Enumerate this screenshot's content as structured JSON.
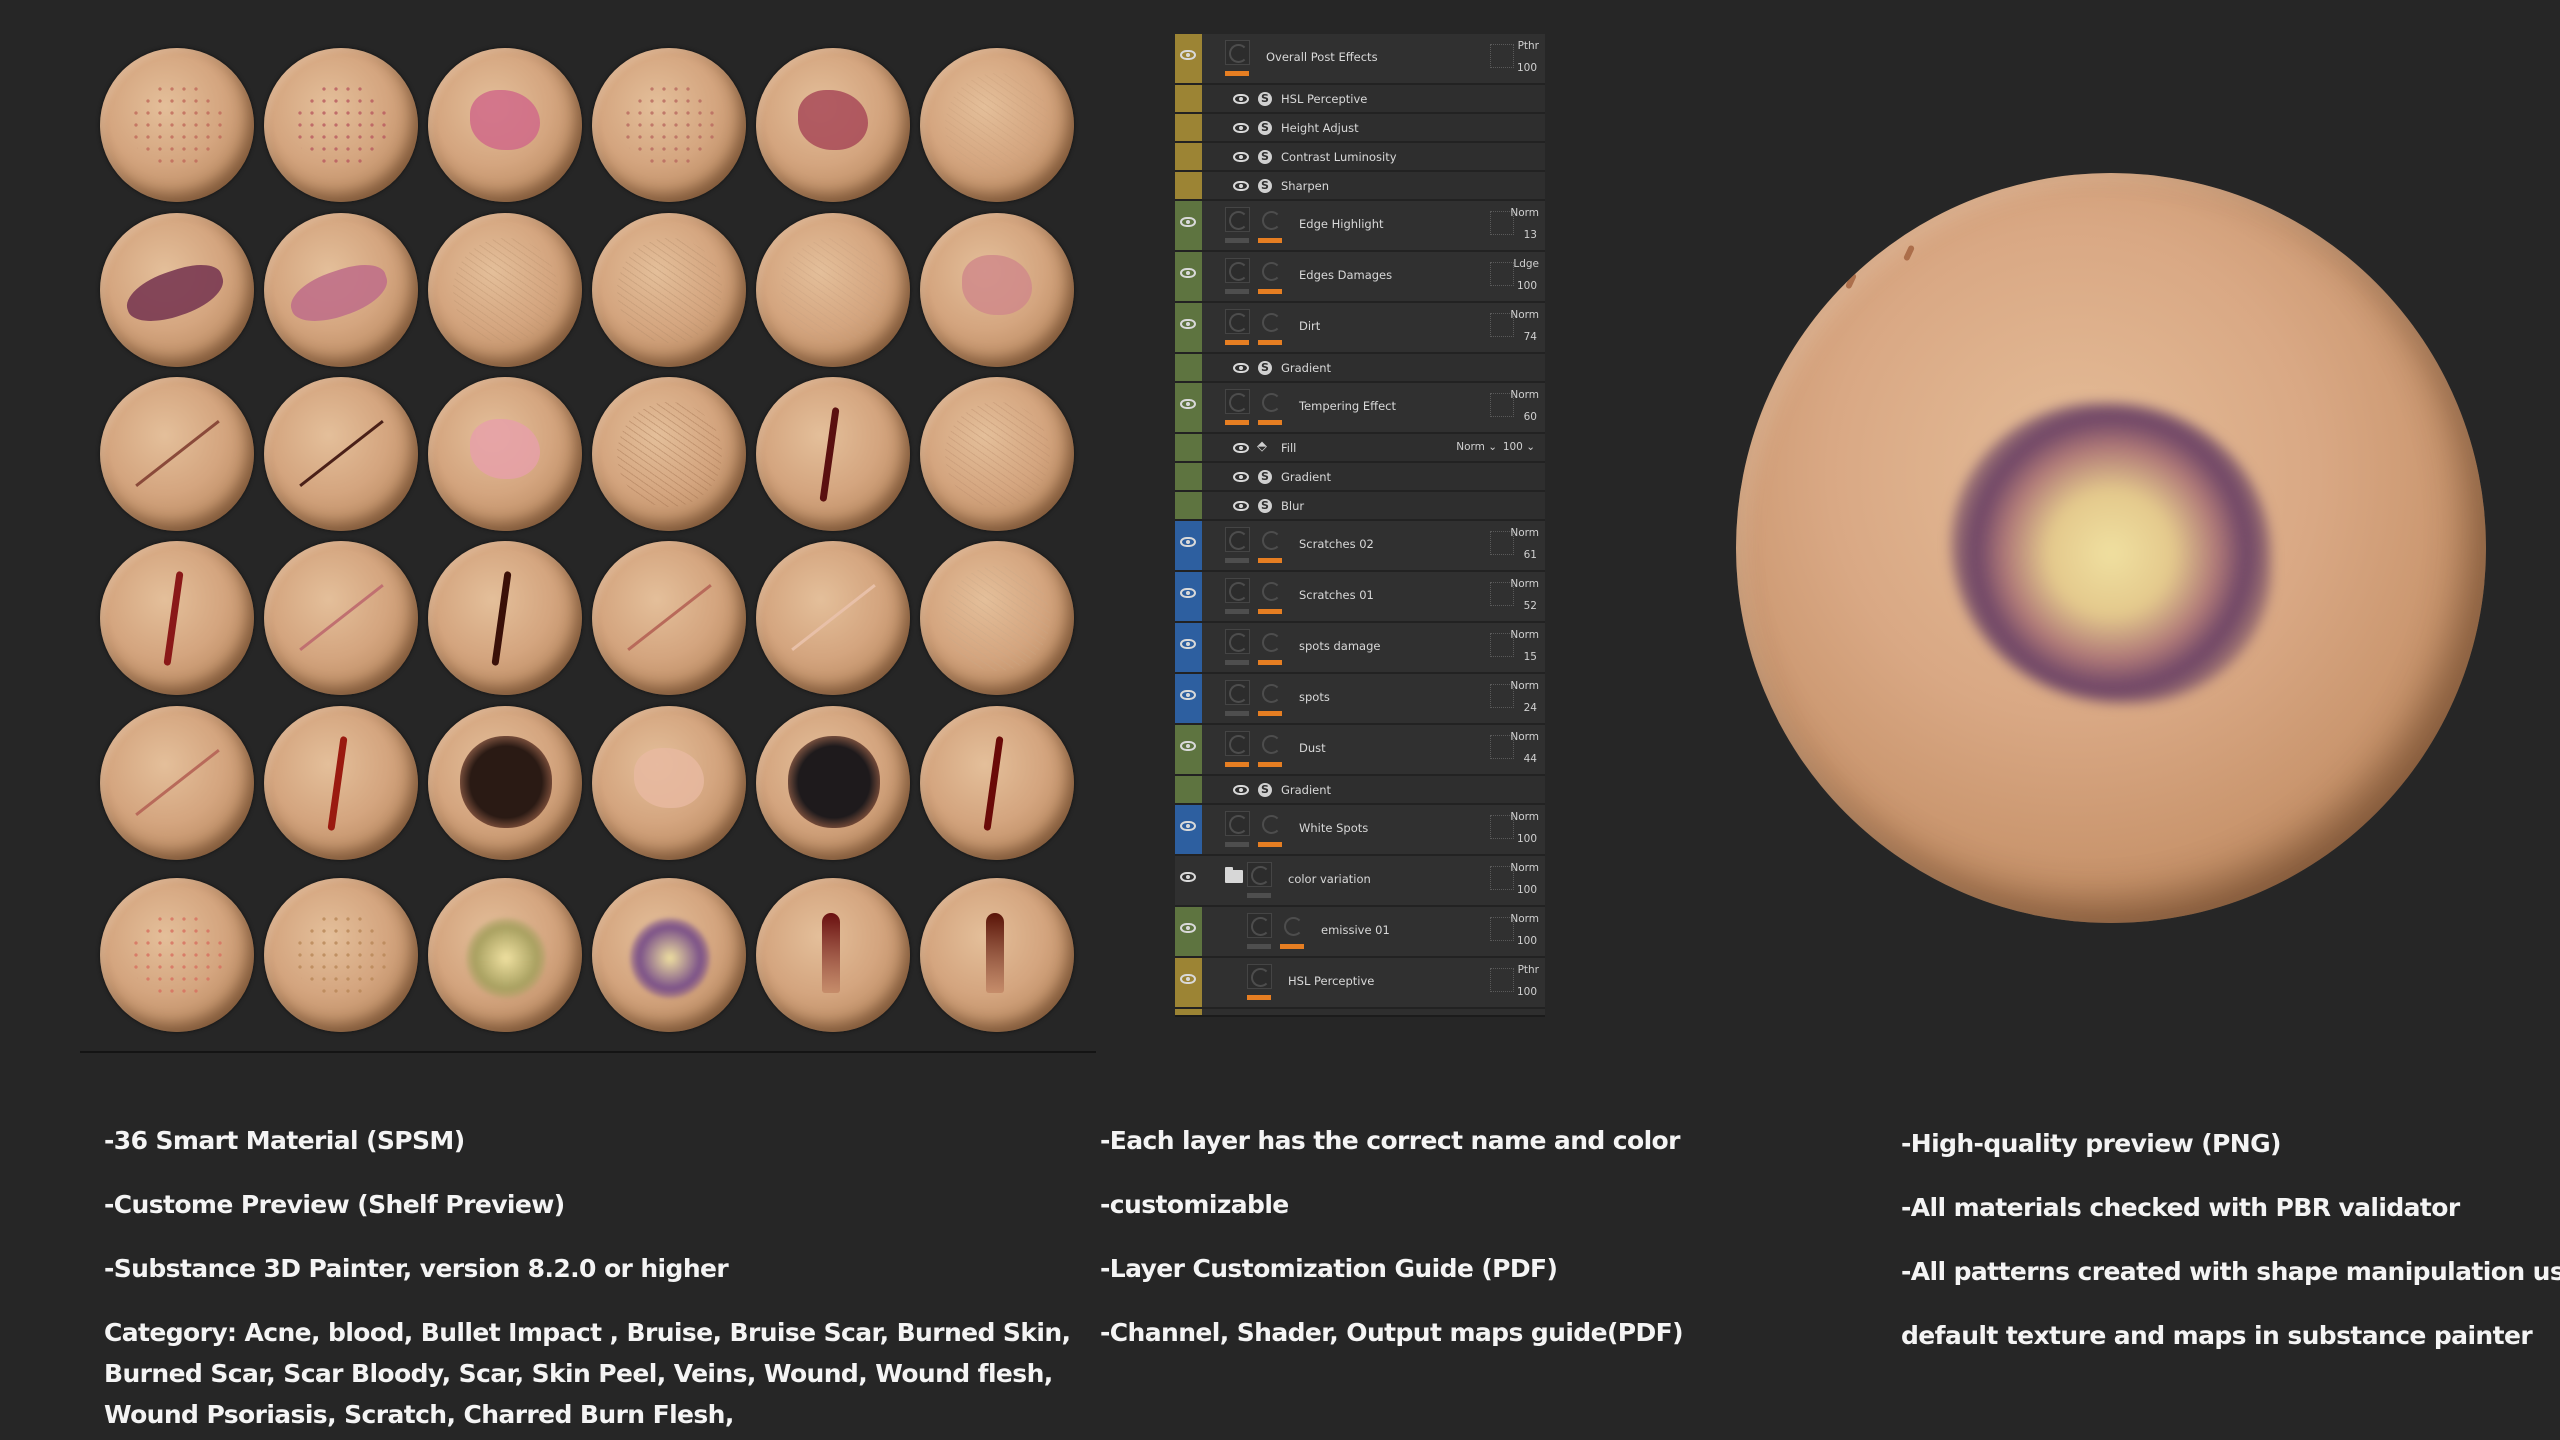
{
  "sphere_grid": {
    "count": 36,
    "rows": [
      [
        "acne red spots",
        "dense acne patches",
        "pink psoriasis patch",
        "acne scattered spots",
        "raw flesh wound",
        "bumpy skin texture"
      ],
      [
        "skin peel wound",
        "raw skin peel",
        "fine skin cracks",
        "cracked dry skin",
        "subtle veins",
        "pink rash"
      ],
      [
        "stitched scar",
        "dark scratch line",
        "burn pink patch",
        "hair-like scars",
        "bloody cut",
        "stretch texture"
      ],
      [
        "vertical bloody cut",
        "healed pink scratch",
        "dark scab wound",
        "scar line",
        "faint scratch",
        "rough burned scar"
      ],
      [
        "thin scratch",
        "bloody slash",
        "charred burn",
        "burned skin flesh",
        "charred burn flesh",
        "thin vertical cut"
      ],
      [
        "red acne dots",
        "bumpy acne",
        "green-yellow bruise",
        "purple bruise",
        "bullet impact drips",
        "bullet wound drip"
      ]
    ]
  },
  "layer_panel": {
    "layers": [
      {
        "kind": "main",
        "name": "Overall Post Effects",
        "strip": "#9c8434",
        "blend": "Pthr",
        "opacity": "100",
        "thumbs": 1,
        "bars": [
          "orange"
        ]
      },
      {
        "kind": "sub",
        "name": "HSL Perceptive",
        "strip": "#9c8434",
        "icon": "substance-icon"
      },
      {
        "kind": "sub",
        "name": "Height Adjust",
        "strip": "#9c8434",
        "icon": "substance-icon"
      },
      {
        "kind": "sub",
        "name": "Contrast Luminosity",
        "strip": "#9c8434",
        "icon": "substance-icon"
      },
      {
        "kind": "sub",
        "name": "Sharpen",
        "strip": "#9c8434",
        "icon": "substance-icon"
      },
      {
        "kind": "main",
        "name": "Edge Highlight",
        "strip": "#5e7440",
        "blend": "Norm",
        "opacity": "13",
        "thumbs": 2,
        "bars": [
          "gray",
          "orange"
        ]
      },
      {
        "kind": "main",
        "name": "Edges Damages",
        "strip": "#5e7440",
        "blend": "Ldge",
        "opacity": "100",
        "thumbs": 2,
        "bars": [
          "gray",
          "orange"
        ]
      },
      {
        "kind": "main",
        "name": "Dirt",
        "strip": "#5e7440",
        "blend": "Norm",
        "opacity": "74",
        "thumbs": 2,
        "bars": [
          "orange",
          "orange"
        ]
      },
      {
        "kind": "sub",
        "name": "Gradient",
        "strip": "#5e7440",
        "icon": "substance-icon"
      },
      {
        "kind": "main",
        "name": "Tempering Effect",
        "strip": "#5e7440",
        "blend": "Norm",
        "opacity": "60",
        "thumbs": 2,
        "bars": [
          "orange",
          "orange"
        ]
      },
      {
        "kind": "sub",
        "name": "Fill",
        "strip": "#5e7440",
        "icon": "fill-icon",
        "blend": "Norm",
        "opacity": "100"
      },
      {
        "kind": "sub",
        "name": "Gradient",
        "strip": "#5e7440",
        "icon": "substance-icon"
      },
      {
        "kind": "sub",
        "name": "Blur",
        "strip": "#5e7440",
        "icon": "substance-icon"
      },
      {
        "kind": "main",
        "name": "Scratches 02",
        "strip": "#2d5fa0",
        "blend": "Norm",
        "opacity": "61",
        "thumbs": 2,
        "bars": [
          "gray",
          "orange"
        ]
      },
      {
        "kind": "main",
        "name": "Scratches 01",
        "strip": "#2d5fa0",
        "blend": "Norm",
        "opacity": "52",
        "thumbs": 2,
        "bars": [
          "gray",
          "orange"
        ]
      },
      {
        "kind": "main",
        "name": "spots damage",
        "strip": "#2d5fa0",
        "blend": "Norm",
        "opacity": "15",
        "thumbs": 2,
        "bars": [
          "gray",
          "orange"
        ]
      },
      {
        "kind": "main",
        "name": "spots",
        "strip": "#2d5fa0",
        "blend": "Norm",
        "opacity": "24",
        "thumbs": 2,
        "bars": [
          "gray",
          "orange"
        ]
      },
      {
        "kind": "main",
        "name": "Dust",
        "strip": "#5e7440",
        "blend": "Norm",
        "opacity": "44",
        "thumbs": 2,
        "bars": [
          "orange",
          "orange"
        ]
      },
      {
        "kind": "sub",
        "name": "Gradient",
        "strip": "#5e7440",
        "icon": "substance-icon"
      },
      {
        "kind": "main",
        "name": "White Spots",
        "strip": "#2d5fa0",
        "blend": "Norm",
        "opacity": "100",
        "thumbs": 2,
        "bars": [
          "gray",
          "orange"
        ]
      },
      {
        "kind": "folder",
        "name": "color variation",
        "strip": "",
        "blend": "Norm",
        "opacity": "100"
      },
      {
        "kind": "nested",
        "name": "emissive 01",
        "strip": "#5e7440",
        "blend": "Norm",
        "opacity": "100"
      },
      {
        "kind": "nested-single",
        "name": "HSL Perceptive",
        "strip": "#9c8434",
        "blend": "Pthr",
        "opacity": "100"
      }
    ]
  },
  "preview": {
    "description": "purple-yellow bruise large sphere preview"
  },
  "features": {
    "col1": [
      "-36 Smart Material  (SPSM)",
      "-Custome Preview (Shelf Preview)",
      "-Substance 3D Painter, version 8.2.0 or higher",
      "Category: Acne, blood, Bullet Impact , Bruise, Bruise Scar, Burned Skin,",
      "Burned Scar, Scar Bloody, Scar, Skin Peel, Veins, Wound, Wound flesh,",
      "Wound Psoriasis, Scratch, Charred Burn Flesh,"
    ],
    "col2": [
      "-Each layer has the correct name and color",
      "-customizable",
      "-Layer Customization Guide (PDF)",
      "-Channel, Shader, Output maps guide(PDF)"
    ],
    "col3": [
      "-High-quality preview (PNG)",
      "-All materials checked with PBR validator",
      "-All patterns created with shape manipulation usin",
      "default texture and maps in substance painter"
    ]
  },
  "colors": {
    "background": "#262626",
    "accent_orange": "#e67e22",
    "strip_gold": "#9c8434",
    "strip_green": "#5e7440",
    "strip_blue": "#2d5fa0"
  }
}
